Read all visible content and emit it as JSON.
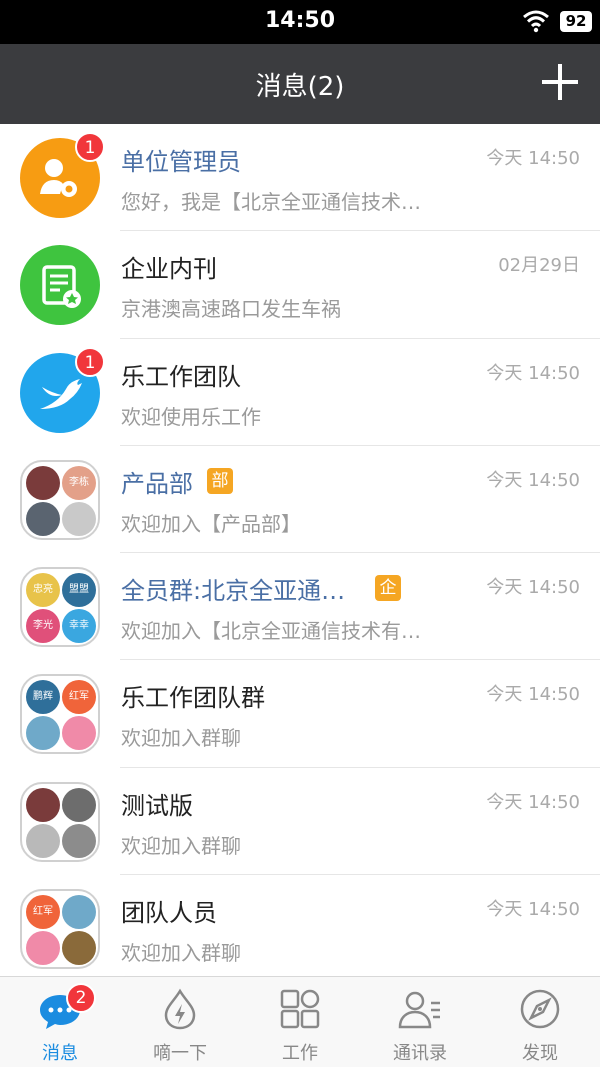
{
  "status_bar": {
    "time": "14:50",
    "battery": "92"
  },
  "nav": {
    "title": "消息(2)"
  },
  "conversations": [
    {
      "name": "单位管理员",
      "preview": "您好，我是【北京全亚通信技术…",
      "time": "今天 14:50",
      "badge": "1"
    },
    {
      "name": "企业内刊",
      "preview": "京港澳高速路口发生车祸",
      "time": "02月29日"
    },
    {
      "name": "乐工作团队",
      "preview": "欢迎使用乐工作",
      "time": "今天 14:50",
      "badge": "1"
    },
    {
      "name": "产品部",
      "tag": "部",
      "preview": "欢迎加入【产品部】",
      "time": "今天 14:50",
      "members": [
        "",
        "李栋",
        "",
        ""
      ]
    },
    {
      "name": "全员群:北京全亚通…",
      "tag": "企",
      "preview": "欢迎加入【北京全亚通信技术有…",
      "time": "今天 14:50",
      "members": [
        "忠亮",
        "盟盟",
        "李光",
        "幸幸"
      ]
    },
    {
      "name": "乐工作团队群",
      "preview": "欢迎加入群聊",
      "time": "今天 14:50",
      "members": [
        "鹏辉",
        "红军",
        "",
        ""
      ]
    },
    {
      "name": "测试版",
      "preview": "欢迎加入群聊",
      "time": "今天 14:50",
      "members": [
        "",
        "",
        "",
        ""
      ]
    },
    {
      "name": "团队人员",
      "preview": "欢迎加入群聊",
      "time": "今天 14:50",
      "members": [
        "红军",
        "",
        "",
        ""
      ]
    }
  ],
  "tabs": [
    {
      "label": "消息",
      "badge": "2",
      "icon": "chat-bubble-icon"
    },
    {
      "label": "嘀一下",
      "icon": "lightning-drop-icon"
    },
    {
      "label": "工作",
      "icon": "grid-icon"
    },
    {
      "label": "通讯录",
      "icon": "contacts-icon"
    },
    {
      "label": "发现",
      "icon": "compass-icon"
    }
  ],
  "colors": {
    "accent": "#1b8ce0",
    "navbar": "#3b3c3f",
    "badge": "#f1363b",
    "tag": "#f5a623"
  }
}
